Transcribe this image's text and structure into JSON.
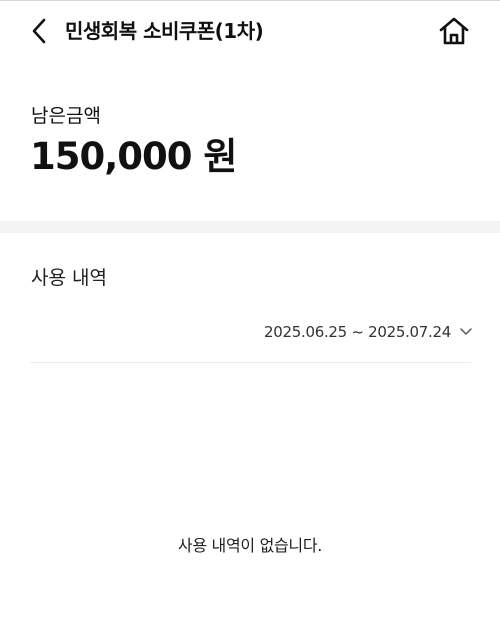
{
  "header": {
    "title": "민생회복 소비쿠폰(1차)",
    "back_icon": "chevron-left-icon",
    "home_icon": "home-icon"
  },
  "balance": {
    "label": "남은금액",
    "amount": "150,000 원"
  },
  "history": {
    "title": "사용 내역",
    "date_range": "2025.06.25 ~ 2025.07.24",
    "dropdown_icon": "chevron-down-icon",
    "empty_message": "사용 내역이 없습니다."
  }
}
